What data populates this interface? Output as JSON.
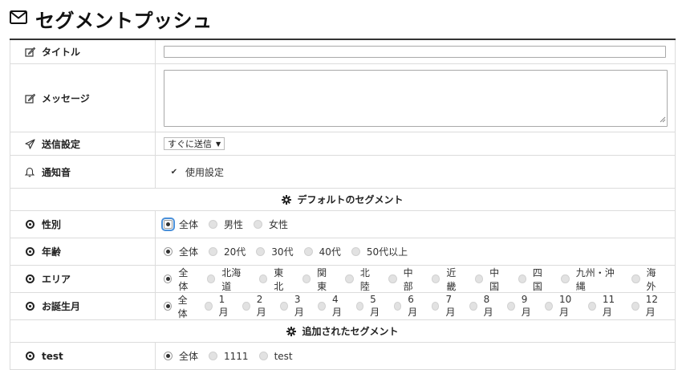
{
  "header": {
    "title": "セグメントプッシュ",
    "icon": "envelope-icon"
  },
  "form": {
    "title_label": "タイトル",
    "title_value": "",
    "message_label": "メッセージ",
    "message_value": "",
    "send_label": "送信設定",
    "send_value": "すぐに送信",
    "sound_label": "通知音",
    "sound_checkbox_label": "使用設定",
    "sound_checked": true
  },
  "default_section": {
    "label": "デフォルトのセグメント",
    "icon": "gear-icon"
  },
  "segments": [
    {
      "label": "性別",
      "options": [
        "全体",
        "男性",
        "女性"
      ],
      "selected": 0,
      "focused": true
    },
    {
      "label": "年齢",
      "options": [
        "全体",
        "20代",
        "30代",
        "40代",
        "50代以上"
      ],
      "selected": 0
    },
    {
      "label": "エリア",
      "options": [
        "全体",
        "北海道",
        "東北",
        "関東",
        "北陸",
        "中部",
        "近畿",
        "中国",
        "四国",
        "九州・沖縄",
        "海外"
      ],
      "selected": 0
    },
    {
      "label": "お誕生月",
      "options": [
        "全体",
        "1月",
        "2月",
        "3月",
        "4月",
        "5月",
        "6月",
        "7月",
        "8月",
        "9月",
        "10月",
        "11月",
        "12月"
      ],
      "selected": 0
    }
  ],
  "added_section": {
    "label": "追加されたセグメント",
    "icon": "gear-icon"
  },
  "added_segments": [
    {
      "label": "test",
      "options": [
        "全体",
        "1111",
        "test"
      ],
      "selected": 0
    }
  ]
}
